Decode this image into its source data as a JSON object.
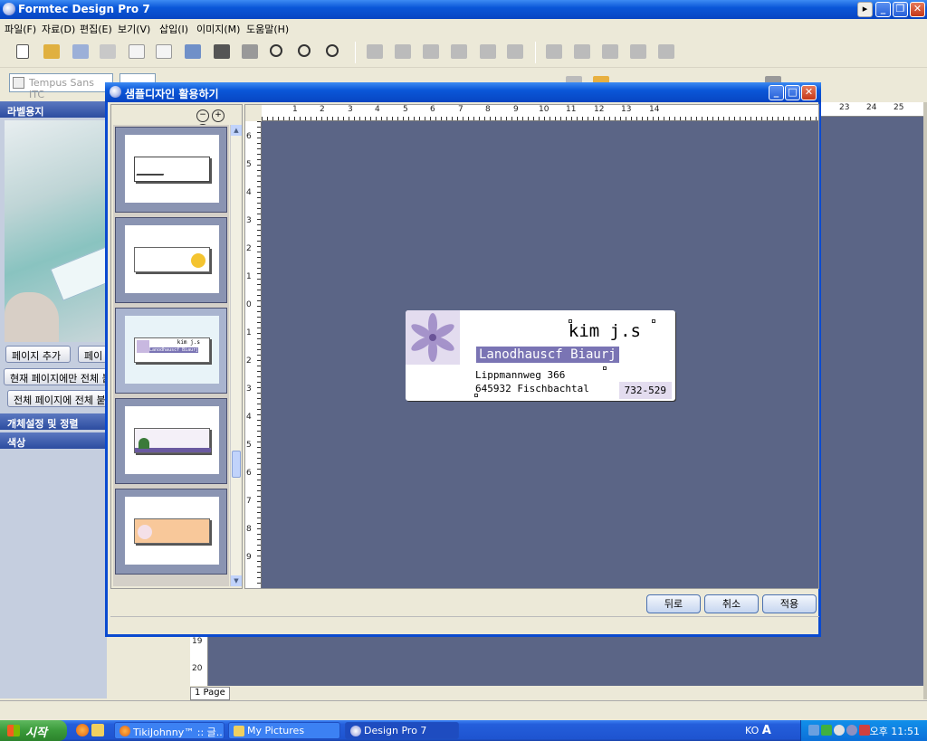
{
  "app": {
    "title": "Formtec Design Pro 7",
    "menu": [
      "파일(F)",
      "자료(D)",
      "편집(E)",
      "보기(V)",
      "삽입(I)",
      "이미지(M)",
      "도움말(H)"
    ]
  },
  "toolbar": {
    "font_name": "Tempus Sans ITC"
  },
  "left_panel": {
    "header_label": "라벨용지",
    "add_page_label": "페이지 추가",
    "page_label": "페이",
    "apply_current_label": "현재 페이지에만 전체 붙",
    "apply_all_label": "전체 페이지에 전체 붙여",
    "section_align": "개체설정 및 정렬",
    "section_color": "색상"
  },
  "main": {
    "ruler_numbers": [
      "23",
      "24",
      "25"
    ],
    "side_ruler": [
      "19",
      "20"
    ],
    "page_tab": "1 Page"
  },
  "dialog": {
    "title": "샘플디자인 활용하기",
    "ruler_top": [
      "1",
      "2",
      "3",
      "4",
      "5",
      "6",
      "7",
      "8",
      "9",
      "10",
      "11",
      "12",
      "13",
      "14"
    ],
    "ruler_left": [
      "6",
      "5",
      "4",
      "3",
      "2",
      "1",
      "0",
      "1",
      "2",
      "3",
      "4",
      "5",
      "6",
      "7",
      "8",
      "9"
    ],
    "buttons": {
      "back": "뒤로",
      "cancel": "취소",
      "apply": "적용"
    },
    "card": {
      "name": "kim j.s",
      "company": "Lanodhauscf Biaurj",
      "address_line1": "Lippmannweg 366",
      "address_line2": "645932 Fischbachtal",
      "phone": "732-529"
    },
    "thumbnails": [
      {
        "id": "thumb-1",
        "selected": false
      },
      {
        "id": "thumb-2",
        "selected": false
      },
      {
        "id": "thumb-3",
        "selected": true,
        "mini_name": "kim j.s",
        "mini_company": "Lanodhauscf Biaurj"
      },
      {
        "id": "thumb-4",
        "selected": false
      },
      {
        "id": "thumb-5",
        "selected": false
      }
    ]
  },
  "taskbar": {
    "start_label": "시작",
    "tasks": [
      "TikiJohnny™ :: 글...",
      "My Pictures",
      "Design Pro 7"
    ],
    "language": "KO",
    "clock": "오후 11:51"
  },
  "colors": {
    "xp_blue": "#0a57d8",
    "canvas": "#5b6586",
    "company_highlight": "#7a74b4",
    "flower_bg": "#e3dcef"
  }
}
